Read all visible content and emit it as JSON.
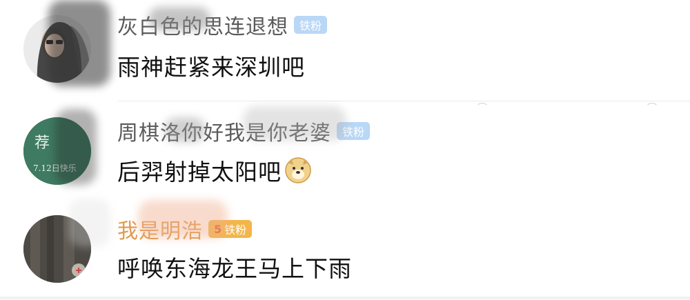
{
  "comments": [
    {
      "username": "灰白色的思连退想",
      "badge": "铁粉",
      "text": "雨神赶紧来深圳吧",
      "emoji": ""
    },
    {
      "username": "周棋洛你好我是你老婆",
      "badge": "铁粉",
      "text": "后羿射掉太阳吧",
      "emoji": "doge"
    },
    {
      "username": "我是明浩",
      "badge": "铁粉",
      "badge_level": "5",
      "text": "呼唤东海龙王马上下雨",
      "emoji": ""
    }
  ],
  "avatar2_text": [
    "荐",
    "7.12日快乐"
  ],
  "colors": {
    "username": "#5a5a5a",
    "username_highlight": "#e09a4c",
    "badge_blue": "#b9d7f6",
    "badge_gold": "#f2b64a",
    "avatar_green": "#3f7a62"
  }
}
